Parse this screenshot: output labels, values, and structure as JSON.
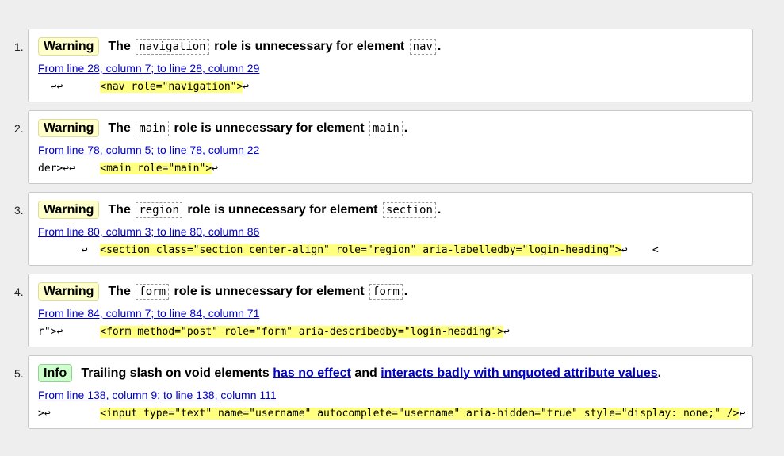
{
  "messages": [
    {
      "number": "1.",
      "type": "Warning",
      "prefix": "The",
      "code1": "navigation",
      "middle": "role is unnecessary for element",
      "code2": "nav",
      "suffix": ".",
      "location": "From line 28, column 7; to line 28, column 29",
      "extract_before": "  ↩↩      ",
      "extract_highlight": "<nav role=\"navigation\">",
      "extract_after": "↩"
    },
    {
      "number": "2.",
      "type": "Warning",
      "prefix": "The",
      "code1": "main",
      "middle": "role is unnecessary for element",
      "code2": "main",
      "suffix": ".",
      "location": "From line 78, column 5; to line 78, column 22",
      "extract_before": "der>↩↩    ",
      "extract_highlight": "<main role=\"main\">",
      "extract_after": "↩"
    },
    {
      "number": "3.",
      "type": "Warning",
      "prefix": "The",
      "code1": "region",
      "middle": "role is unnecessary for element",
      "code2": "section",
      "suffix": ".",
      "location": "From line 80, column 3; to line 80, column 86",
      "extract_before": "       ↩  ",
      "extract_highlight": "<section class=\"section center-align\" role=\"region\" aria-labelledby=\"login-heading\">",
      "extract_after": "↩    <"
    },
    {
      "number": "4.",
      "type": "Warning",
      "prefix": "The",
      "code1": "form",
      "middle": "role is unnecessary for element",
      "code2": "form",
      "suffix": ".",
      "location": "From line 84, column 7; to line 84, column 71",
      "extract_before": "r\">↩      ",
      "extract_highlight": "<form method=\"post\" role=\"form\" aria-describedby=\"login-heading\">",
      "extract_after": "↩"
    },
    {
      "number": "5.",
      "type": "Info",
      "text1": "Trailing slash on void elements",
      "link1": "has no effect",
      "text2": "and",
      "link2": "interacts badly with unquoted attribute values",
      "suffix": ".",
      "location": "From line 138, column 9; to line 138, column 111",
      "extract_before": ">↩        ",
      "extract_highlight": "<input type=\"text\" name=\"username\" autocomplete=\"username\" aria-hidden=\"true\" style=\"display: none;\" />",
      "extract_after": "↩"
    }
  ]
}
